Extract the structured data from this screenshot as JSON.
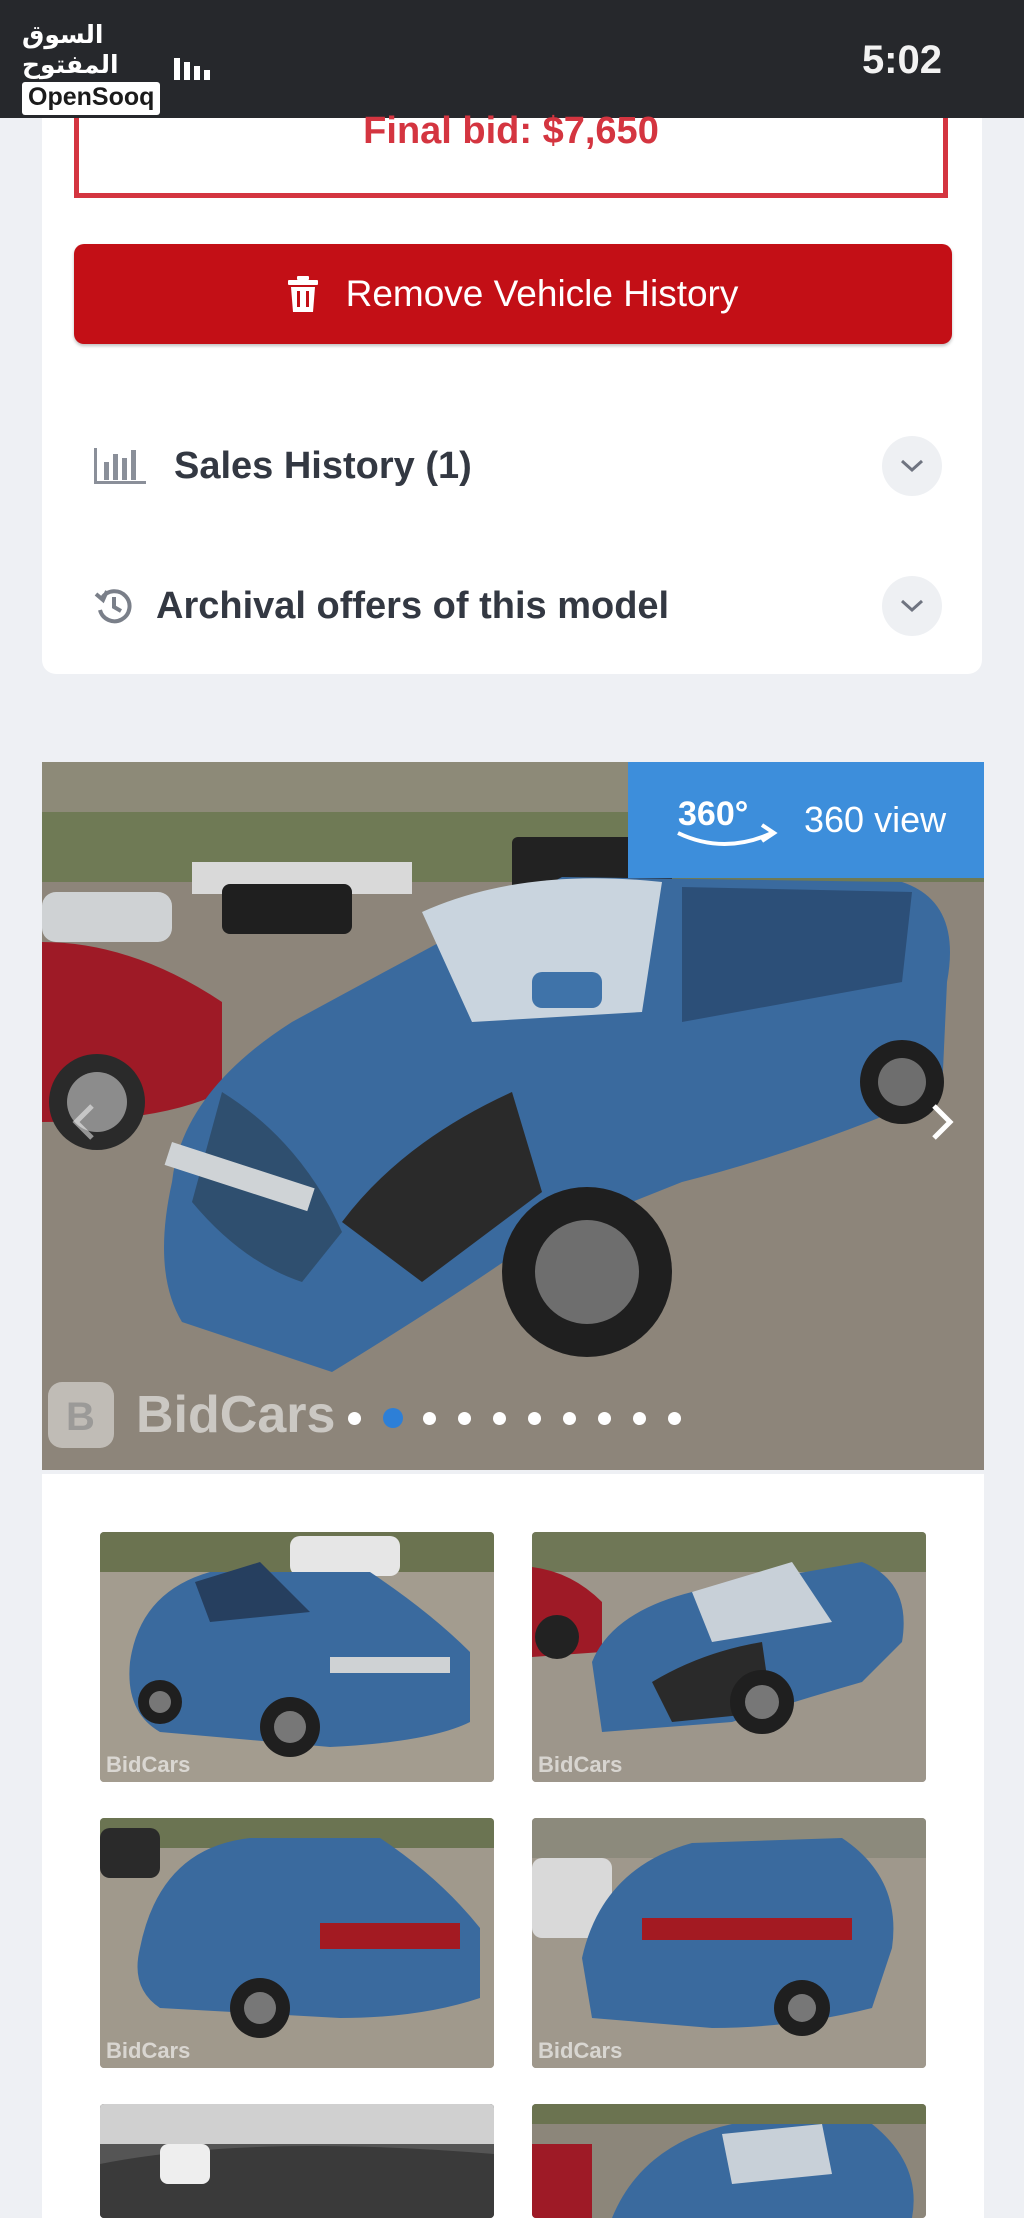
{
  "status_bar": {
    "time": "5:02",
    "brand_arabic": "السوق المفتوح",
    "brand_english": "OpenSooq"
  },
  "auction": {
    "final_bid": "Final bid: $7,650"
  },
  "actions": {
    "remove_history_label": "Remove Vehicle History"
  },
  "accordions": [
    {
      "label": "Sales History (1)",
      "icon": "bar-chart-icon"
    },
    {
      "label": "Archival offers of this model",
      "icon": "history-clock-icon"
    }
  ],
  "gallery": {
    "badge_360": "360°",
    "view_360_label": "360 view",
    "watermark": "BidCars",
    "dots_total": 10,
    "active_dot": 2,
    "thumbnail_watermark": "BidCars"
  },
  "colors": {
    "final_bid_red": "#d43540",
    "remove_button": "#c30f16",
    "view360_blue": "#3d8edb",
    "active_dot": "#2d7fd7",
    "car_blue": "#3a6a9e"
  }
}
